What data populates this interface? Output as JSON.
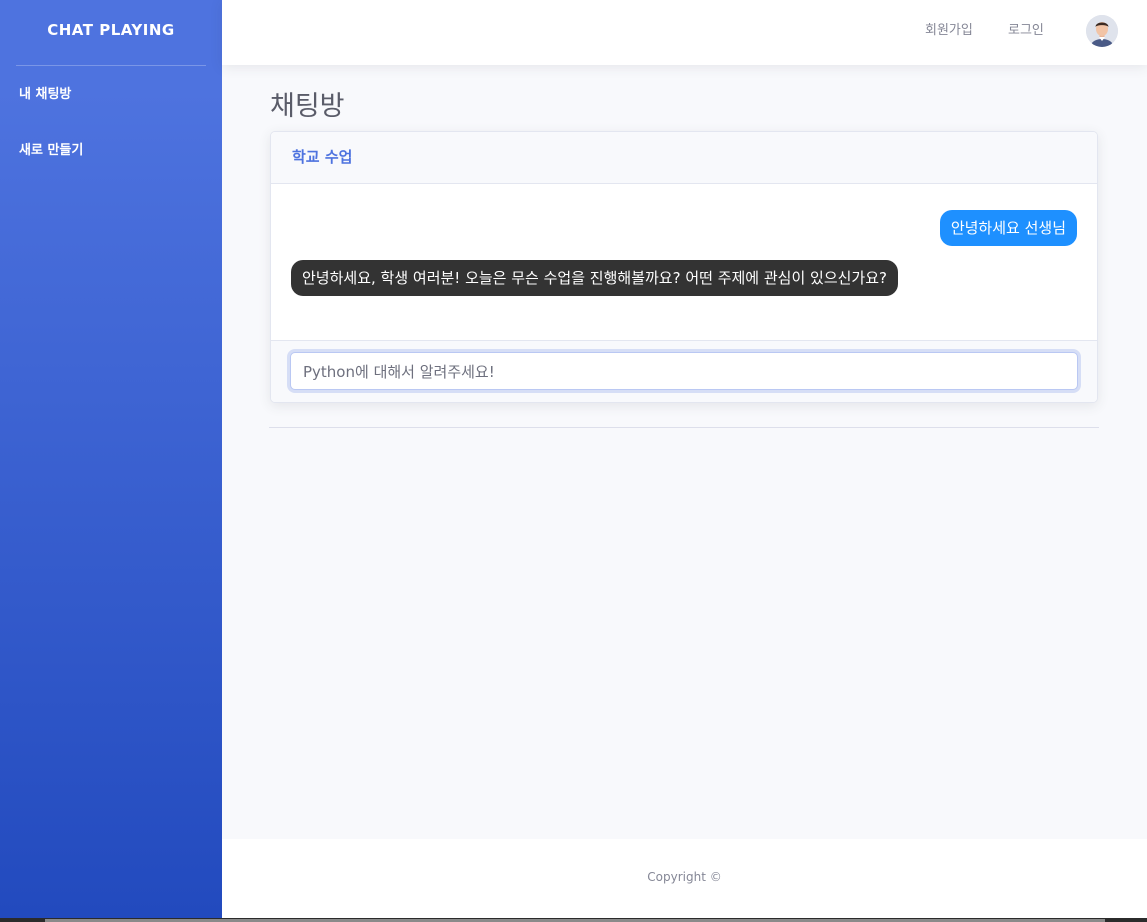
{
  "sidebar": {
    "brand": "CHAT PLAYING",
    "items": [
      {
        "label": "내 채팅방"
      },
      {
        "label": "새로 만들기"
      }
    ],
    "gradient_top": "#4e73df",
    "gradient_bottom": "#224abe"
  },
  "topbar": {
    "signup_label": "회원가입",
    "login_label": "로그인",
    "avatar_icon": "user-avatar-icon"
  },
  "main": {
    "page_title": "채팅방",
    "chat_card": {
      "title": "학교 수업",
      "messages": [
        {
          "sender": "me",
          "text": "안녕하세요 선생님",
          "color": "#1e90ff"
        },
        {
          "sender": "bot",
          "text": "안녕하세요, 학생 여러분! 오늘은 무슨 수업을 진행해볼까요? 어떤 주제에 관심이 있으신가요?",
          "color": "#333333"
        }
      ],
      "input_value": "Python에 대해서 알려주세요!"
    }
  },
  "footer": {
    "copyright": "Copyright ©"
  }
}
